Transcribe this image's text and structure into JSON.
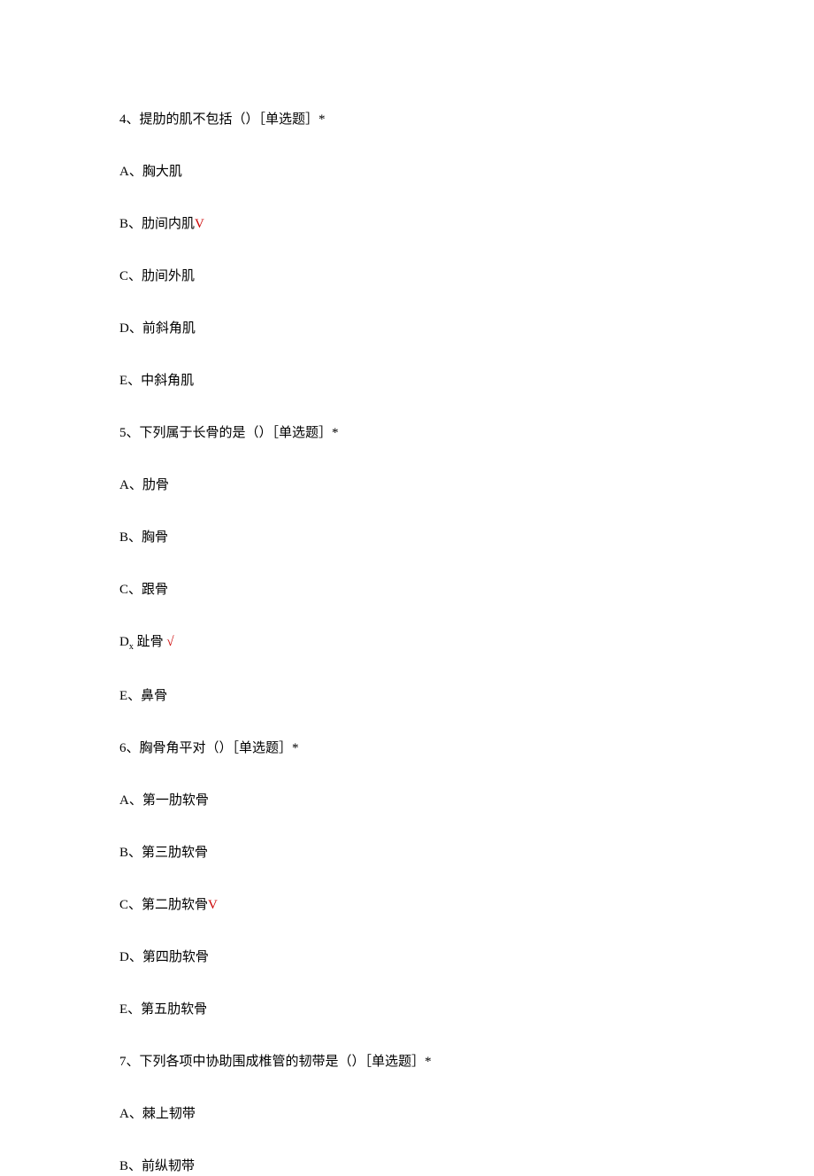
{
  "questions": [
    {
      "number": "4、",
      "text": "提肋的肌不包括（）［单选题］*",
      "options": [
        {
          "label": "A、",
          "text": "胸大肌",
          "correct": false
        },
        {
          "label": "B、",
          "text": "肋间内肌",
          "correct": true,
          "checkSymbol": "V"
        },
        {
          "label": "C、",
          "text": "肋间外肌",
          "correct": false
        },
        {
          "label": "D、",
          "text": "前斜角肌",
          "correct": false
        },
        {
          "label": "E、",
          "text": "中斜角肌",
          "correct": false
        }
      ]
    },
    {
      "number": "5、",
      "text": "下列属于长骨的是（）［单选题］*",
      "options": [
        {
          "label": "A、",
          "text": "肋骨",
          "correct": false
        },
        {
          "label": "B、",
          "text": "胸骨",
          "correct": false
        },
        {
          "label": "C、",
          "text": "跟骨",
          "correct": false
        },
        {
          "label": "D",
          "labelSubscript": "x",
          "text": " 趾骨 ",
          "correct": true,
          "checkSymbol": "√"
        },
        {
          "label": "E、",
          "text": "鼻骨",
          "correct": false
        }
      ]
    },
    {
      "number": "6、",
      "text": "胸骨角平对（）［单选题］*",
      "options": [
        {
          "label": "A、",
          "text": "第一肋软骨",
          "correct": false
        },
        {
          "label": "B、",
          "text": "第三肋软骨",
          "correct": false
        },
        {
          "label": "C、",
          "text": "第二肋软骨",
          "correct": true,
          "checkSymbol": "V"
        },
        {
          "label": "D、",
          "text": "第四肋软骨",
          "correct": false
        },
        {
          "label": "E、",
          "text": "第五肋软骨",
          "correct": false
        }
      ]
    },
    {
      "number": "7、",
      "text": "下列各项中协助围成椎管的韧带是（）［单选题］*",
      "options": [
        {
          "label": "A、",
          "text": "棘上韧带",
          "correct": false
        },
        {
          "label": "B、",
          "text": "前纵韧带",
          "correct": false
        }
      ]
    }
  ]
}
